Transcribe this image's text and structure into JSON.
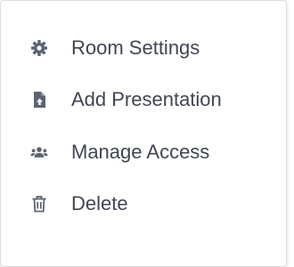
{
  "menu": {
    "items": [
      {
        "label": "Room Settings",
        "icon": "gear-icon"
      },
      {
        "label": "Add Presentation",
        "icon": "file-upload-icon"
      },
      {
        "label": "Manage Access",
        "icon": "users-icon"
      },
      {
        "label": "Delete",
        "icon": "trash-icon"
      }
    ]
  },
  "colors": {
    "text": "#3f4652",
    "icon": "#5b6472",
    "border": "#dcdcdc",
    "background": "#ffffff"
  }
}
